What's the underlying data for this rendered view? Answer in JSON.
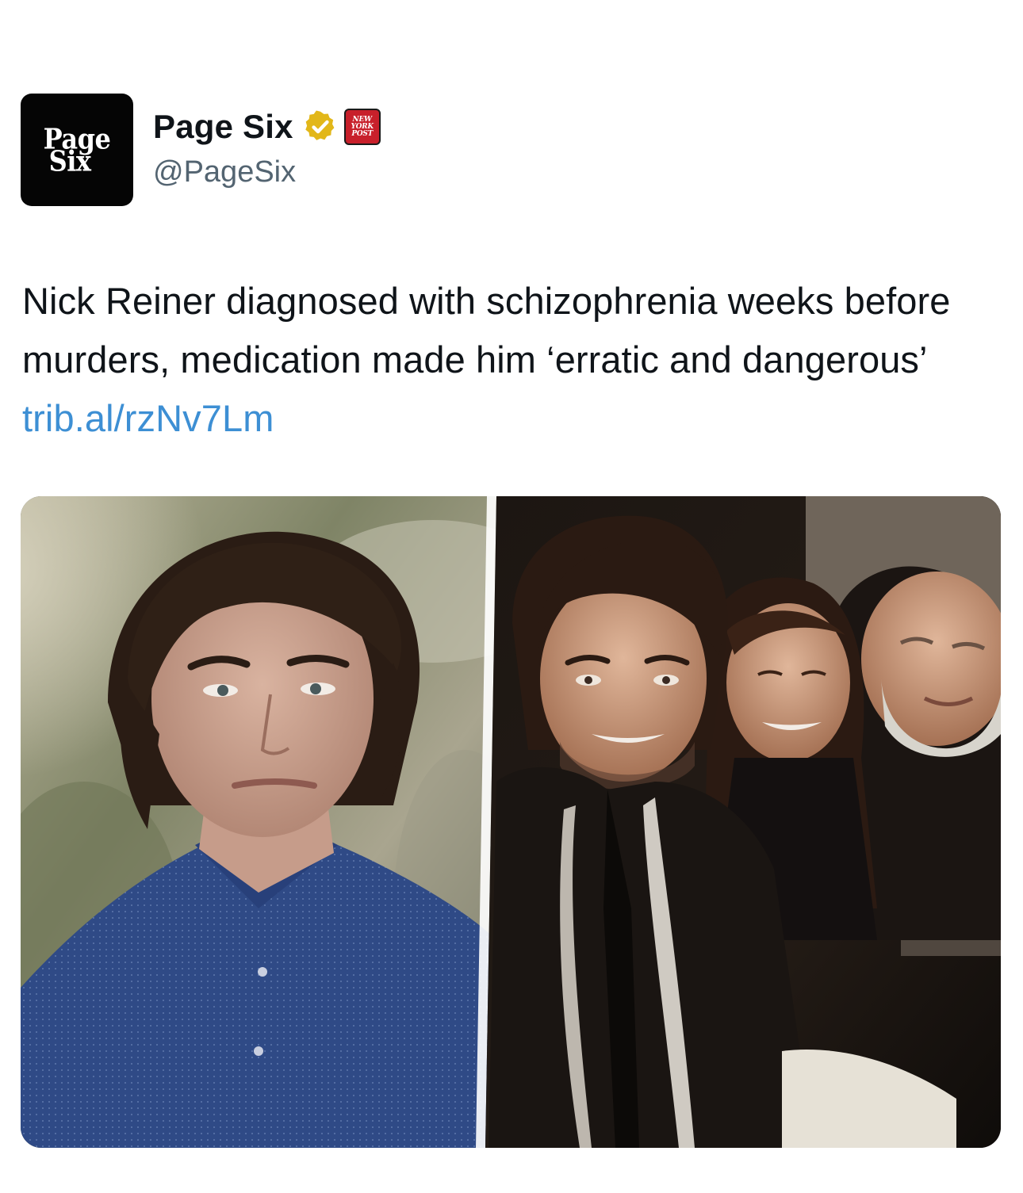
{
  "author": {
    "avatar_text_line1": "Page",
    "avatar_text_line2": "Six",
    "display_name": "Page Six",
    "handle": "@PageSix",
    "verified": true,
    "affiliate_badge_text": [
      "NEW",
      "YORK",
      "POST"
    ]
  },
  "tweet": {
    "text": "Nick Reiner diagnosed with schizophrenia weeks before murders, medication made him ‘erratic and dangerous’",
    "link_text": "trib.al/rzNv7Lm"
  },
  "media": {
    "image_count": 2,
    "layout": "side-by-side collage"
  },
  "colors": {
    "text_primary": "#0f1419",
    "text_secondary": "#536471",
    "link": "#3d8fd4",
    "verified_gold": "#e2b719",
    "nypost_red": "#c8202b"
  }
}
